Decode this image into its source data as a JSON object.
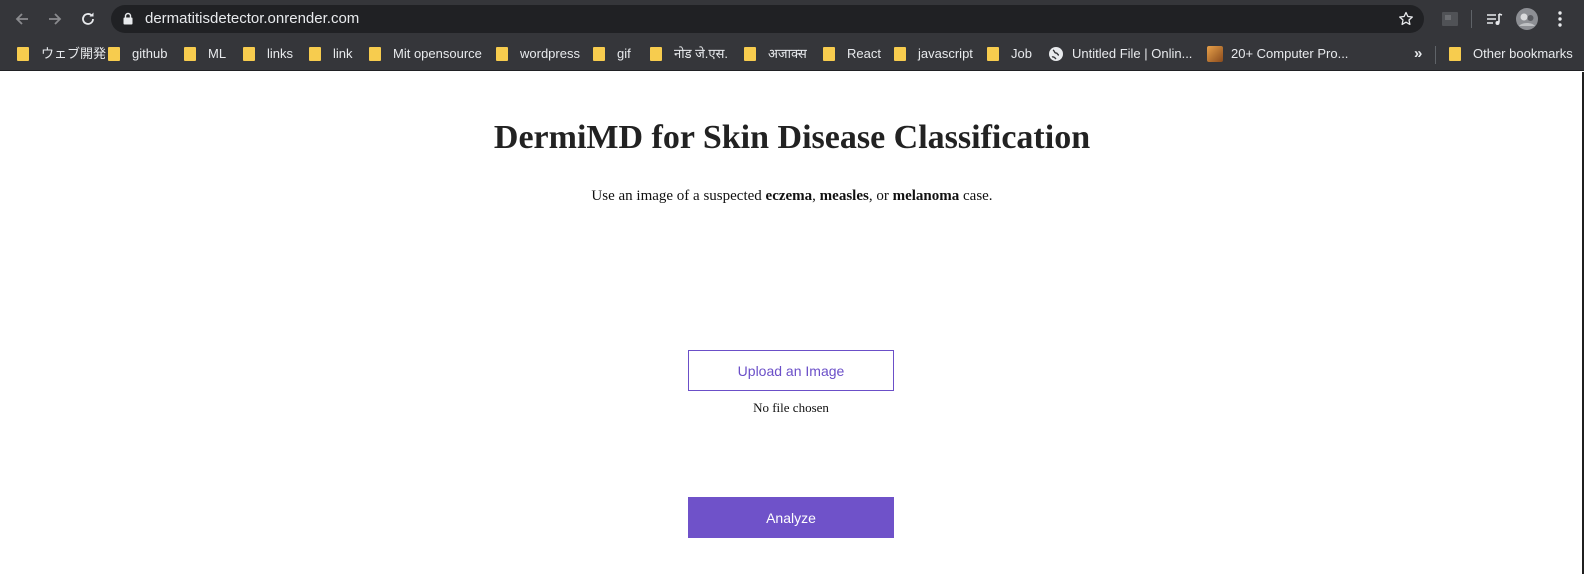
{
  "browser": {
    "url": "dermatitisdetector.onrender.com",
    "more_bookmarks_glyph": "»",
    "bookmarks": [
      {
        "label": "ウェブ開発",
        "icon": "folder-icon"
      },
      {
        "label": "github",
        "icon": "folder-icon"
      },
      {
        "label": "ML",
        "icon": "folder-icon"
      },
      {
        "label": "links",
        "icon": "folder-icon"
      },
      {
        "label": "link",
        "icon": "folder-icon"
      },
      {
        "label": "Mit opensource",
        "icon": "folder-icon"
      },
      {
        "label": "wordpress",
        "icon": "folder-icon"
      },
      {
        "label": "gif",
        "icon": "folder-icon"
      },
      {
        "label": "नोड जे.एस.",
        "icon": "folder-icon"
      },
      {
        "label": "अजाक्स",
        "icon": "folder-icon"
      },
      {
        "label": "React",
        "icon": "folder-icon"
      },
      {
        "label": "javascript",
        "icon": "folder-icon"
      },
      {
        "label": "Job",
        "icon": "folder-icon"
      },
      {
        "label": "Untitled File | Onlin...",
        "icon": "globe-icon"
      },
      {
        "label": "20+ Computer Pro...",
        "icon": "site-favicon"
      }
    ],
    "other_bookmarks": "Other bookmarks",
    "colors": {
      "chrome": "#35363a",
      "omnibox": "#202124",
      "folder": "#f7cc4e"
    }
  },
  "page": {
    "title": "DermiMD for Skin Disease Classification",
    "subtitle": {
      "prefix": "Use an image of a suspected ",
      "term1": "eczema",
      "sep1": ", ",
      "term2": "measles",
      "sep2": ", or ",
      "term3": "melanoma",
      "suffix": " case."
    },
    "upload_label": "Upload an Image",
    "file_status": "No file chosen",
    "analyze_label": "Analyze",
    "colors": {
      "accent": "#6f52c9"
    }
  }
}
